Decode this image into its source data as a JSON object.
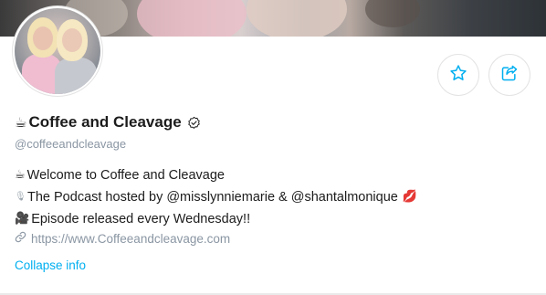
{
  "profile": {
    "name_emoji": "☕",
    "name": "Coffee and Cleavage",
    "handle": "@coffeeandcleavage",
    "verified": true
  },
  "bio": {
    "line1_emoji": "☕",
    "line1": "Welcome to Coffee and Cleavage",
    "line2_emoji": "🎙",
    "line2": "The Podcast hosted by @misslynniemarie & @shantalmonique",
    "line2_trailing_emoji": "💋",
    "line3_emoji": "🎥",
    "line3": "Episode released every Wednesday!!"
  },
  "website": {
    "url": "https://www.Coffeeandcleavage.com"
  },
  "actions": {
    "favorite_icon": "star-icon",
    "share_icon": "share-icon",
    "collapse_label": "Collapse info"
  },
  "colors": {
    "accent": "#00aff0",
    "muted": "#8a96a3",
    "text": "#1c1c1c"
  }
}
